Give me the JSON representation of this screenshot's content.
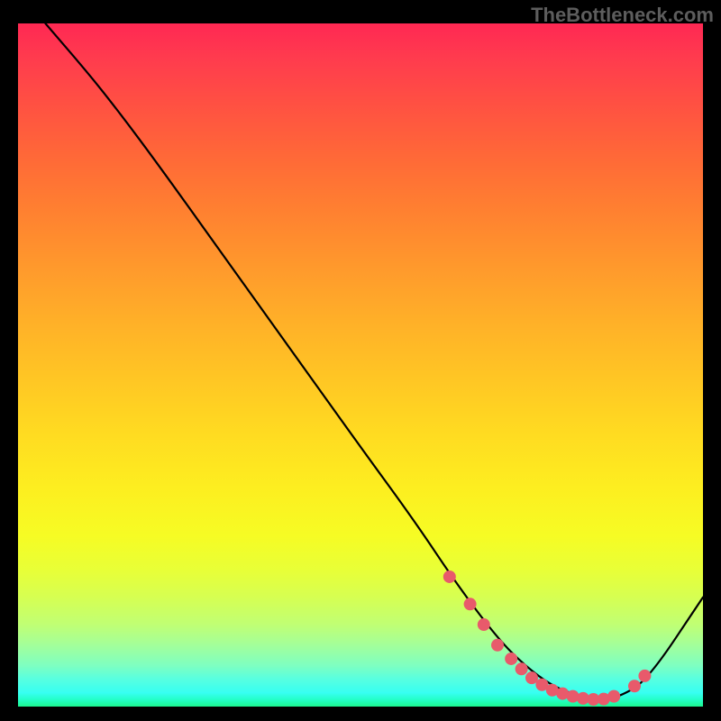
{
  "attribution": "TheBottleneck.com",
  "chart_data": {
    "type": "line",
    "title": "",
    "xlabel": "",
    "ylabel": "",
    "xlim": [
      0,
      100
    ],
    "ylim": [
      0,
      100
    ],
    "series": [
      {
        "name": "bottleneck-curve",
        "x": [
          4,
          10,
          14,
          20,
          30,
          40,
          50,
          58,
          64,
          70,
          74,
          78,
          82,
          85,
          88,
          92,
          100
        ],
        "y": [
          100,
          93,
          88,
          80,
          66,
          52,
          38,
          27,
          18,
          10,
          6,
          3,
          1.5,
          1,
          1.5,
          4,
          16
        ]
      }
    ],
    "markers": {
      "name": "highlighted-points",
      "color": "#e85a6b",
      "points": [
        {
          "x": 63,
          "y": 19
        },
        {
          "x": 66,
          "y": 15
        },
        {
          "x": 68,
          "y": 12
        },
        {
          "x": 70,
          "y": 9
        },
        {
          "x": 72,
          "y": 7
        },
        {
          "x": 73.5,
          "y": 5.5
        },
        {
          "x": 75,
          "y": 4.2
        },
        {
          "x": 76.5,
          "y": 3.2
        },
        {
          "x": 78,
          "y": 2.4
        },
        {
          "x": 79.5,
          "y": 1.9
        },
        {
          "x": 81,
          "y": 1.5
        },
        {
          "x": 82.5,
          "y": 1.2
        },
        {
          "x": 84,
          "y": 1.05
        },
        {
          "x": 85.5,
          "y": 1.1
        },
        {
          "x": 87,
          "y": 1.5
        },
        {
          "x": 90,
          "y": 3
        },
        {
          "x": 91.5,
          "y": 4.5
        }
      ]
    },
    "gradient_stops": [
      {
        "pos": 0,
        "color": "#ff2853"
      },
      {
        "pos": 50,
        "color": "#ffce22"
      },
      {
        "pos": 80,
        "color": "#e8ff37"
      },
      {
        "pos": 100,
        "color": "#1cf68f"
      }
    ]
  }
}
